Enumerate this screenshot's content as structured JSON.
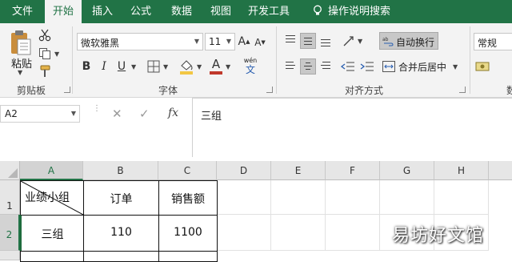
{
  "tabs": [
    "文件",
    "开始",
    "插入",
    "公式",
    "数据",
    "视图",
    "开发工具"
  ],
  "active_tab": "开始",
  "tell_me": "操作说明搜索",
  "clipboard": {
    "paste_label": "粘贴",
    "group_label": "剪贴板"
  },
  "font": {
    "name": "微软雅黑",
    "size": "11",
    "group_label": "字体",
    "bold": "B",
    "italic": "I",
    "underline": "U",
    "phonetic_top": "wén",
    "phonetic_bottom": "文",
    "grow": "A",
    "shrink": "A",
    "font_color_letter": "A"
  },
  "alignment": {
    "wrap_text": "自动换行",
    "merge_center": "合并后居中",
    "group_label": "对齐方式"
  },
  "number": {
    "format": "常规"
  },
  "formula_bar": {
    "name_box": "A2",
    "cancel": "✕",
    "enter": "✓",
    "fx": "fx",
    "content": "三组"
  },
  "columns": [
    "A",
    "B",
    "C",
    "D",
    "E",
    "F",
    "G",
    "H"
  ],
  "rows": [
    "1",
    "2"
  ],
  "cells": {
    "A1": "业绩小组",
    "B1": "订单",
    "C1": "销售额",
    "A2": "三组",
    "B2": "110",
    "C2": "1100"
  },
  "watermark": "易坊好文馆",
  "colors": {
    "accent": "#217346",
    "ribbon_bg": "#f3f3f3",
    "header_bg": "#e6e6e6"
  }
}
